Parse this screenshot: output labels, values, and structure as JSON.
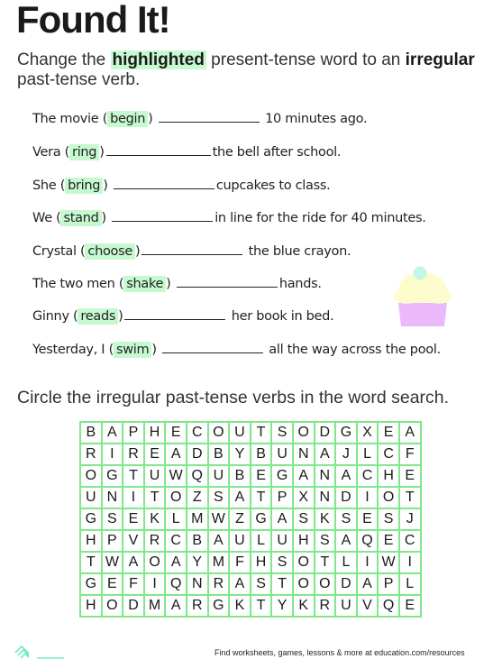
{
  "title": "Found It!",
  "instructions": {
    "part1": "Change the ",
    "highlight": "highlighted",
    "part2": " present-tense word to an ",
    "bold": "irregular",
    "part3": "past-tense verb."
  },
  "sentences": [
    {
      "before": "The movie (",
      "verb": "begin",
      "after_paren": ") ",
      "after": " 10 minutes ago."
    },
    {
      "before": "Vera (",
      "verb": "ring",
      "after_paren": ")",
      "after": "the bell after school."
    },
    {
      "before": "She (",
      "verb": "bring",
      "after_paren": ") ",
      "after": "cupcakes to class."
    },
    {
      "before": "We (",
      "verb": "stand",
      "after_paren": ") ",
      "after": "in line for the ride for 40 minutes."
    },
    {
      "before": "Crystal (",
      "verb": "choose",
      "after_paren": ")",
      "after": " the blue crayon."
    },
    {
      "before": "The two men (",
      "verb": "shake",
      "after_paren": ") ",
      "after": "hands."
    },
    {
      "before": "Ginny (",
      "verb": "reads",
      "after_paren": ")",
      "after": "   her book in bed."
    },
    {
      "before": "Yesterday, I (",
      "verb": "swim",
      "after_paren": ") ",
      "after": " all the way across the pool."
    }
  ],
  "word_search_instruction": "Circle the irregular past-tense verbs in the word search.",
  "grid": [
    [
      "B",
      "A",
      "P",
      "H",
      "E",
      "C",
      "O",
      "U",
      "T",
      "S",
      "O",
      "D",
      "G",
      "X",
      "E",
      "A"
    ],
    [
      "R",
      "I",
      "R",
      "E",
      "A",
      "D",
      "B",
      "Y",
      "B",
      "U",
      "N",
      "A",
      "J",
      "L",
      "C",
      "F"
    ],
    [
      "O",
      "G",
      "T",
      "U",
      "W",
      "Q",
      "U",
      "B",
      "E",
      "G",
      "A",
      "N",
      "A",
      "C",
      "H",
      "E"
    ],
    [
      "U",
      "N",
      "I",
      "T",
      "O",
      "Z",
      "S",
      "A",
      "T",
      "P",
      "X",
      "N",
      "D",
      "I",
      "O",
      "T"
    ],
    [
      "G",
      "S",
      "E",
      "K",
      "L",
      "M",
      "W",
      "Z",
      "G",
      "A",
      "S",
      "K",
      "S",
      "E",
      "S",
      "J"
    ],
    [
      "H",
      "P",
      "V",
      "R",
      "C",
      "B",
      "A",
      "U",
      "L",
      "U",
      "H",
      "S",
      "A",
      "Q",
      "E",
      "C"
    ],
    [
      "T",
      "W",
      "A",
      "O",
      "A",
      "Y",
      "M",
      "F",
      "H",
      "S",
      "O",
      "T",
      "L",
      "I",
      "W",
      "I"
    ],
    [
      "G",
      "E",
      "F",
      "I",
      "Q",
      "N",
      "R",
      "A",
      "S",
      "T",
      "O",
      "O",
      "D",
      "A",
      "P",
      "L"
    ],
    [
      "H",
      "O",
      "D",
      "M",
      "A",
      "R",
      "G",
      "K",
      "T",
      "Y",
      "K",
      "R",
      "U",
      "V",
      "Q",
      "E"
    ]
  ],
  "footer": "Find worksheets, games, lessons & more at education.com/resources",
  "logo_icon": "education-com-logo",
  "colors": {
    "highlight": "#c6f9d0",
    "grid_line": "#7ee88a",
    "cupcake_frosting": "#fdfccc",
    "cupcake_liner": "#ebb8fb",
    "cupcake_cherry": "#c6f7e6"
  }
}
